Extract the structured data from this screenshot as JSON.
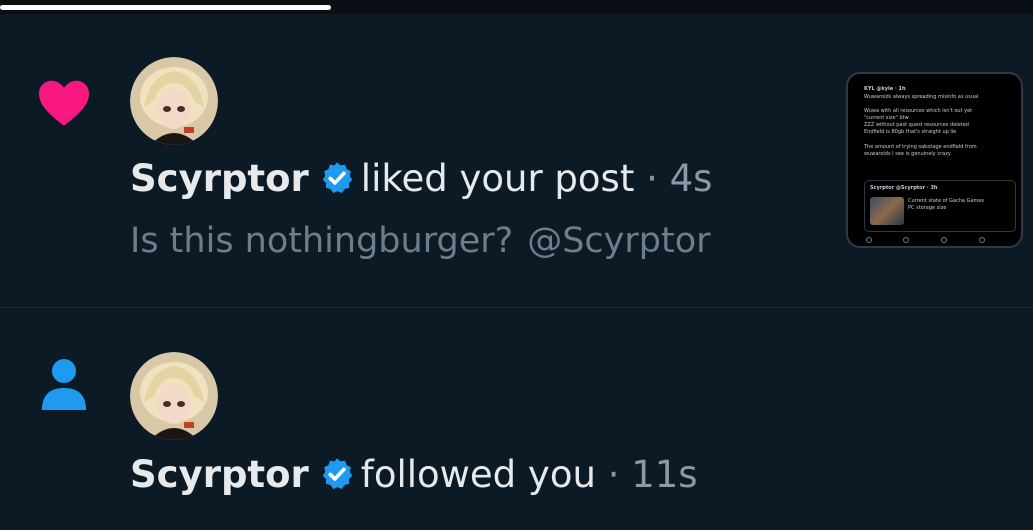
{
  "progress": {
    "value": 0.32
  },
  "notifications": [
    {
      "type": "like",
      "icon": "heart-icon",
      "user": "Scyrptor",
      "action": "liked your post",
      "separator": "·",
      "time": "4s",
      "post_text": "Is this nothingburger?",
      "post_mention": "@Scyrptor",
      "preview_lines": [
        "KYL @kyle · 1h",
        "Wuwaroids always spreading misinfo as usual",
        "Wuwa with all resources which isn't out yet",
        "\"current size\" btw",
        "ZZZ without past quest resources deleted",
        "Endfield is 80gb that's straight up lie",
        "The amount of trying sabotage endfield from",
        "wuwaroids I see is genuinely crazy",
        "Scyrptor @Scyrptor · 3h",
        "Current state of Gacha Games",
        "PC storage size"
      ]
    },
    {
      "type": "follow",
      "icon": "person-icon",
      "user": "Scyrptor",
      "action": "followed you",
      "separator": "·",
      "time": "11s"
    }
  ],
  "colors": {
    "background": "#0c1a25",
    "like": "#f91880",
    "follow": "#1d9bf0",
    "verified": "#1d9bf0",
    "muted": "#8b98a5"
  }
}
